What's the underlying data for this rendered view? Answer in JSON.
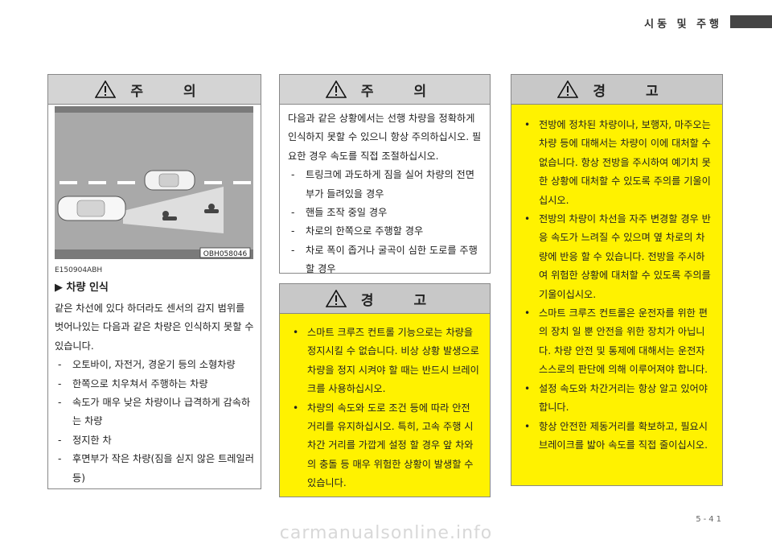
{
  "header": {
    "title": "시동 및 주행"
  },
  "col1": {
    "heading": "주 의",
    "figure": {
      "code": "OBH058046",
      "caption_code": "E150904ABH"
    },
    "section_title": "▶ 차량 인식",
    "intro": "같은 차선에 있다 하더라도 센서의 감지 범위를 벗어나있는 다음과 같은 차량은 인식하지 못할 수 있습니다.",
    "items": [
      "오토바이, 자전거, 경운기 등의 소형차량",
      "한쪽으로 치우쳐서 주행하는 차량",
      "속도가 매우 낮은 차량이나 급격하게 감속하는 차량",
      "정지한 차",
      "후면부가 작은 차량(짐을 싣지 않은 트레일러 등)"
    ]
  },
  "col2_top": {
    "heading": "주 의",
    "intro": "다음과 같은 상황에서는 선행 차량을 정확하게 인식하지 못할 수 있으니 항상 주의하십시오. 필요한 경우 속도를 직접 조절하십시오.",
    "items": [
      "트링크에 과도하게 짐을 실어 차량의 전면부가 들려있을 경우",
      "핸들 조작 중일 경우",
      "차로의 한쪽으로 주행할 경우",
      "차로 폭이 좁거나 굴곡이 심한 도로를 주행할 경우"
    ]
  },
  "col2_bottom": {
    "heading": "경 고",
    "items": [
      "스마트 크루즈 컨트롤 기능으로는 차량을 정지시킬 수 없습니다. 비상 상황 발생으로 차량을 정지 시켜야 할 때는 반드시 브레이크를 사용하십시오.",
      "차량의 속도와 도로 조건 등에 따라 안전 거리를 유지하십시오. 특히, 고속 주행 시 차간 거리를 가깝게 설정 할 경우 앞 차와의 충돌 등 매우 위험한 상황이 발생할 수 있습니다."
    ]
  },
  "col3": {
    "heading": "경 고",
    "items": [
      "전방에 정차된 차량이나, 보행자, 마주오는 차량 등에 대해서는 차량이 이에 대처할 수 없습니다. 항상 전방을 주시하여 예기치 못한 상황에 대처할 수 있도록 주의를 기울이십시오.",
      "전방의 차량이 차선을 자주 변경할 경우 반응 속도가 느려질 수 있으며 옆 차로의 차량에 반응 할 수 있습니다. 전방을 주시하여 위험한 상황에 대처할 수 있도록 주의를 기울이십시오.",
      "스마트 크루즈 컨트롤은 운전자를 위한 편의 장치 일 뿐 안전을 위한 장치가 아닙니다. 차량 안전 및 통제에 대해서는 운전자 스스로의 판단에 의해 이루어져야 합니다.",
      "설정 속도와 차간거리는 항상 알고 있어야 합니다.",
      "항상 안전한 제동거리를 확보하고, 필요시 브레이크를 밟아 속도를 직접 줄이십시오."
    ]
  },
  "footer": {
    "page": "5-41",
    "watermark": "carmanualsonline.info"
  },
  "colors": {
    "yellow": "#fff200",
    "header_gray": "#d4d4d4"
  },
  "icons": {
    "caution": "warning-triangle-icon"
  }
}
